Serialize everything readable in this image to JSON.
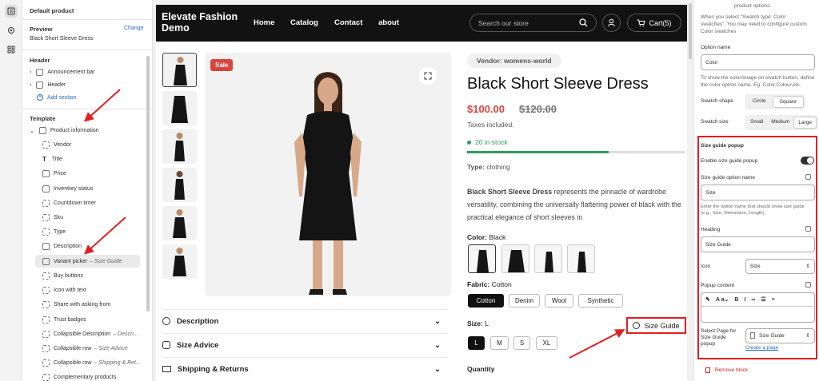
{
  "rail": {
    "icons": [
      "sections-icon",
      "settings-icon",
      "apps-icon"
    ]
  },
  "left": {
    "preview_label": "Default product",
    "preview_heading": "Preview",
    "change_label": "Change",
    "product_name": "Black Short Sleeve Dress",
    "header_heading": "Header",
    "header_items": [
      "Announcement bar",
      "Header"
    ],
    "add_section": "Add section",
    "template_heading": "Template",
    "product_info": "Product information",
    "blocks": [
      {
        "label": "Vendor",
        "sub": ""
      },
      {
        "label": "Title",
        "sub": ""
      },
      {
        "label": "Price",
        "sub": ""
      },
      {
        "label": "Inventory status",
        "sub": ""
      },
      {
        "label": "Countdown timer",
        "sub": ""
      },
      {
        "label": "Sku",
        "sub": ""
      },
      {
        "label": "Type",
        "sub": ""
      },
      {
        "label": "Description",
        "sub": ""
      },
      {
        "label": "Variant picker",
        "sub": "– Size Guide"
      },
      {
        "label": "Buy buttons",
        "sub": ""
      },
      {
        "label": "Icon with text",
        "sub": ""
      },
      {
        "label": "Share with asking from",
        "sub": ""
      },
      {
        "label": "Trust badges",
        "sub": ""
      },
      {
        "label": "Collapsible Description",
        "sub": "– Descri..."
      },
      {
        "label": "Collapsible row",
        "sub": "– Size Advice"
      },
      {
        "label": "Collapsible row",
        "sub": "– Shipping & Ret..."
      },
      {
        "label": "Complementary products",
        "sub": ""
      }
    ]
  },
  "store": {
    "logo": "Elevate Fashion Demo",
    "nav": [
      "Home",
      "Catalog",
      "Contact",
      "about"
    ],
    "search_placeholder": "Search our store",
    "cart": "Cart(5)",
    "sale": "Sale",
    "accordions": [
      "Description",
      "Size Advice",
      "Shipping & Returns"
    ],
    "vendor": "Vendor: womens-world",
    "title": "Black Short Sleeve Dress",
    "price": "$100.00",
    "compare_price": "$120.00",
    "taxes": "Taxes included.",
    "stock": "20 in stock",
    "stock_fraction": 0.65,
    "type_label": "Type:",
    "type_value": "clothing",
    "desc_bold": "Black Short Sleeve Dress",
    "desc_rest": " represents the pinnacle of wardrobe versatility, combining the universally flattering power of black with the practical elegance of short sleeves in",
    "color_label": "Color:",
    "color_value": "Black",
    "fabric_label": "Fabric:",
    "fabric_value": "Cotton",
    "fabrics": [
      "Cotton",
      "Denim",
      "Wool",
      "Synthetic"
    ],
    "size_label": "Size:",
    "size_value": "L",
    "sizes": [
      "L",
      "M",
      "S",
      "XL"
    ],
    "size_guide": "Size Guide",
    "quantity": "Quantity"
  },
  "right": {
    "top_text": "product options.",
    "info_text_1": "When you select \"Swatch type: Color",
    "info_text_2": "swatches\". You may need to configure custom",
    "info_text_3": "Color swatches",
    "option_name_label": "Option name",
    "option_name_value": "Color",
    "option_help_1": "To show the color/image on swatch button, define",
    "option_help_2": "the color option name. Eg. Color,Colour,etc.",
    "swatch_shape_label": "Swatch shape",
    "swatch_shapes": [
      "Circle",
      "Square"
    ],
    "swatch_size_label": "Swatch size",
    "swatch_sizes": [
      "Small",
      "Medium",
      "Large"
    ],
    "sg_heading": "Size guide popup",
    "sg_enable": "Enable size guide popup",
    "sg_option_label": "Size guide option name",
    "sg_option_value": "Size",
    "sg_help_1": "Enter the option name that should show size guide",
    "sg_help_2": "(e.g., Size, Dimension, Length)",
    "heading_label": "Heading",
    "heading_value": "Size Guide",
    "icon_label": "Icon",
    "icon_value": "Size",
    "popup_label": "Popup content",
    "select_page_1": "Select Page for",
    "select_page_2": "Size Guide",
    "select_page_3": "popup",
    "page_value": "Size Guide",
    "create_page": "Create a page",
    "remove_block": "Remove block"
  }
}
